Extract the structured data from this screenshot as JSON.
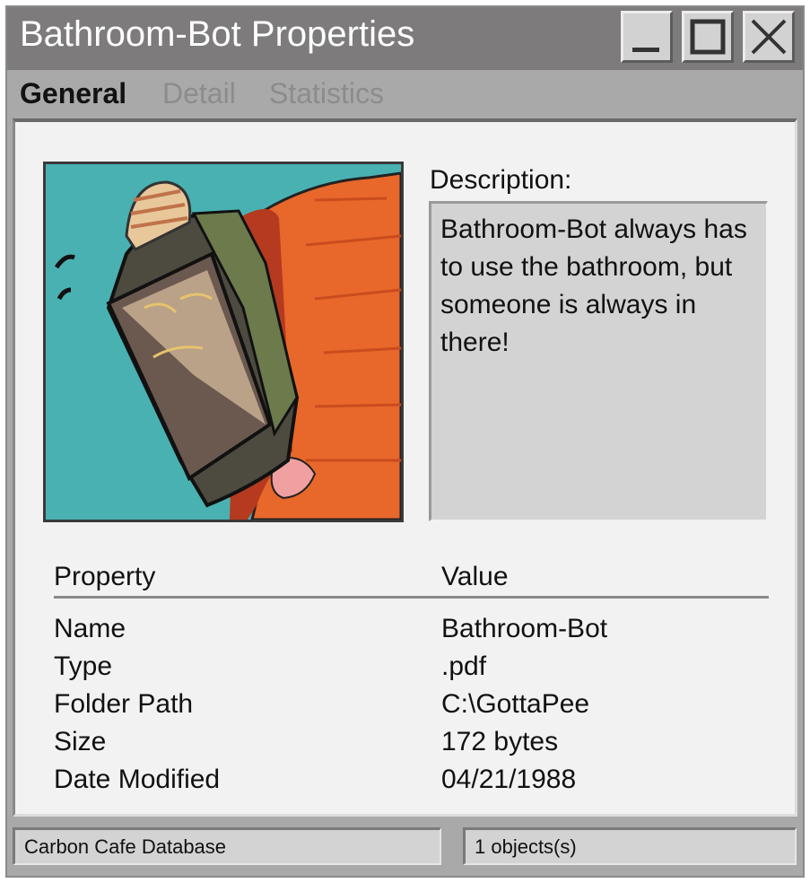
{
  "window": {
    "title": "Bathroom-Bot Properties"
  },
  "controls": {
    "minimize_icon": "minimize-icon",
    "maximize_icon": "maximize-icon",
    "close_icon": "close-icon"
  },
  "tabs": [
    {
      "label": "General",
      "active": true
    },
    {
      "label": "Detail",
      "active": false
    },
    {
      "label": "Statistics",
      "active": false
    }
  ],
  "description": {
    "label": "Description:",
    "text": "Bathroom-Bot always has to use the bathroom, but someone is always in there!"
  },
  "properties": {
    "header": {
      "property": "Property",
      "value": "Value"
    },
    "rows": [
      {
        "property": "Name",
        "value": "Bathroom-Bot"
      },
      {
        "property": "Type",
        "value": ".pdf"
      },
      {
        "property": "Folder Path",
        "value": "C:\\GottaPee"
      },
      {
        "property": "Size",
        "value": "172 bytes"
      },
      {
        "property": "Date Modified",
        "value": "04/21/1988"
      }
    ]
  },
  "statusbar": {
    "left": "Carbon Cafe Database",
    "right": "1 objects(s)"
  },
  "colors": {
    "titlebar": "#7d7b7c",
    "window": "#a9a9a9",
    "panel": "#f2f2f2",
    "portrait_background": "#4ab1b2",
    "character_body": "#e8672a"
  }
}
